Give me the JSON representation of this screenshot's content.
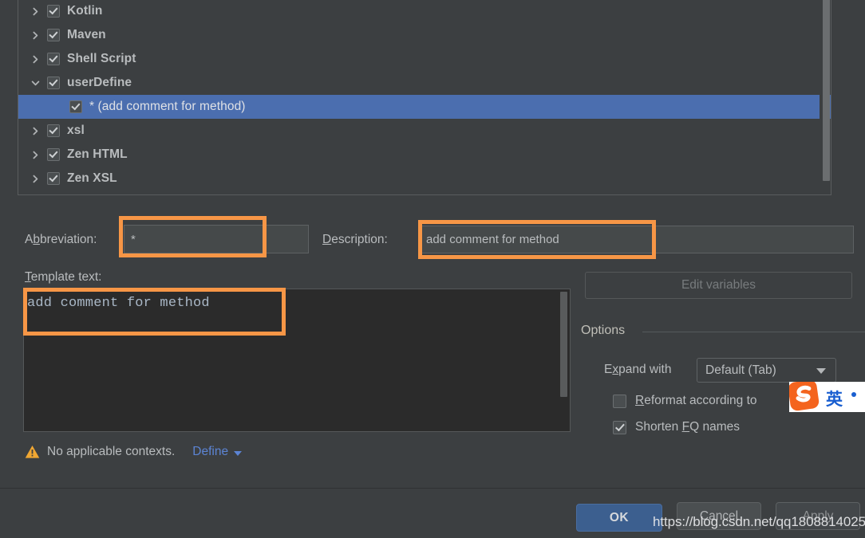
{
  "tree": {
    "items": [
      {
        "label": "Kotlin",
        "arrow": "chevron-right-icon",
        "checked": true,
        "child": false,
        "selected": false
      },
      {
        "label": "Maven",
        "arrow": "chevron-right-icon",
        "checked": true,
        "child": false,
        "selected": false
      },
      {
        "label": "Shell Script",
        "arrow": "chevron-right-icon",
        "checked": true,
        "child": false,
        "selected": false
      },
      {
        "label": "userDefine",
        "arrow": "chevron-down-icon",
        "checked": true,
        "child": false,
        "selected": false
      },
      {
        "label": "* (add comment for method)",
        "arrow": "none",
        "checked": true,
        "child": true,
        "selected": true
      },
      {
        "label": "xsl",
        "arrow": "chevron-right-icon",
        "checked": true,
        "child": false,
        "selected": false
      },
      {
        "label": "Zen HTML",
        "arrow": "chevron-right-icon",
        "checked": true,
        "child": false,
        "selected": false
      },
      {
        "label": "Zen XSL",
        "arrow": "chevron-right-icon",
        "checked": true,
        "child": false,
        "selected": false
      }
    ],
    "scrollbar": "vertical-scrollbar"
  },
  "form": {
    "abbreviation_label": "Abbreviation:",
    "abbreviation_label_pre": "A",
    "abbreviation_label_mnem": "b",
    "abbreviation_label_post": "breviation:",
    "abbreviation_value": "*",
    "description_label_mnem": "D",
    "description_label_post": "escription:",
    "description_value": "add comment for method",
    "template_label_mnem": "T",
    "template_label_post": "emplate text:",
    "template_value": "add comment for method"
  },
  "right": {
    "edit_variables_label": "Edit variables",
    "options_title": "Options",
    "expand_with_label_pre": "E",
    "expand_with_label_mnem": "x",
    "expand_with_label_post": "pand with",
    "expand_with_value": "Default (Tab)",
    "reformat_label_mnem": "R",
    "reformat_label_post": "eformat according to",
    "reformat_checked": false,
    "shorten_label_pre": "Shorten ",
    "shorten_label_mnem": "F",
    "shorten_label_mid": "Q",
    "shorten_label_post": " names",
    "shorten_checked": true
  },
  "status": {
    "warning_text": "No applicable contexts.",
    "define_link": "Define"
  },
  "footer": {
    "ok_label": "OK",
    "cancel_label": "Cancel",
    "apply_label": "Apply"
  },
  "watermark": {
    "url": "https://blog.csdn.net/qq1808814025"
  },
  "ime": {
    "logo": "sogou-s-logo",
    "mode": "英"
  },
  "colors": {
    "background": "#3c3f41",
    "selection_blue": "#4b6eaf",
    "annotation_orange": "#f79646",
    "link_blue": "#5c84d4",
    "primary_button": "#3c5f8f",
    "editor_background": "#2b2b2b",
    "code_text": "#a9b7c6",
    "warning_yellow": "#f0a732"
  }
}
